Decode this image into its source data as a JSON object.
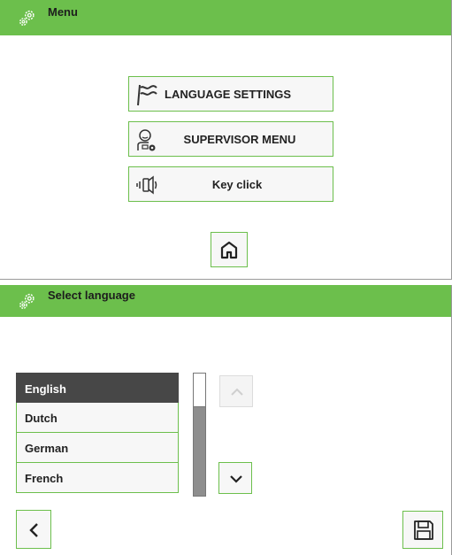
{
  "menu_screen": {
    "title": "Menu",
    "title_icon": "gears-icon",
    "buttons": [
      {
        "label": "LANGUAGE SETTINGS",
        "icon": "flag-icon"
      },
      {
        "label": "SUPERVISOR MENU",
        "icon": "supervisor-icon"
      },
      {
        "label": "Key click",
        "icon": "speaker-vibrate-icon"
      }
    ],
    "home_icon": "home-icon"
  },
  "language_screen": {
    "title": "Select language",
    "title_icon": "gears-icon",
    "languages": [
      "English",
      "Dutch",
      "German",
      "French"
    ],
    "selected_language": "English",
    "scroll_up_icon": "chevron-up-icon",
    "scroll_down_icon": "chevron-down-icon",
    "back_icon": "chevron-left-icon",
    "save_icon": "save-icon"
  },
  "colors": {
    "accent": "#6cbf4c",
    "selected_row": "#474747",
    "scrollbar": "#8e8e8e"
  }
}
